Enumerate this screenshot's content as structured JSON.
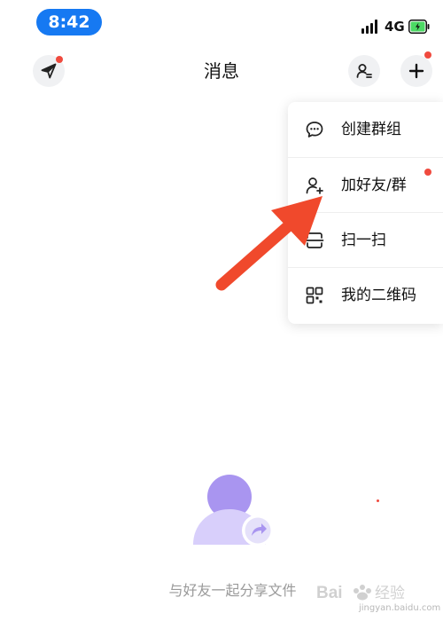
{
  "status_bar": {
    "time": "8:42",
    "network": "4G",
    "time_pill_color": "#1679f2",
    "battery_fill_color": "#4cd964"
  },
  "header": {
    "title": "消息",
    "left_icon": "send-icon",
    "right_icons": [
      "contacts-icon",
      "plus-icon"
    ],
    "badge_color": "#f04a3e"
  },
  "menu": {
    "items": [
      {
        "label": "创建群组",
        "icon": "chat-bubble-icon",
        "badge": false
      },
      {
        "label": "加好友/群",
        "icon": "add-user-icon",
        "badge": true
      },
      {
        "label": "扫一扫",
        "icon": "scan-icon",
        "badge": false
      },
      {
        "label": "我的二维码",
        "icon": "qr-code-icon",
        "badge": false
      }
    ]
  },
  "annotation": {
    "arrow_color": "#f0492c"
  },
  "empty_state": {
    "text": "与好友一起分享文件",
    "illustration_color": "#b09cf0"
  },
  "watermark": {
    "brand": "Bai度经验",
    "url": "jingyan.baidu.com"
  }
}
